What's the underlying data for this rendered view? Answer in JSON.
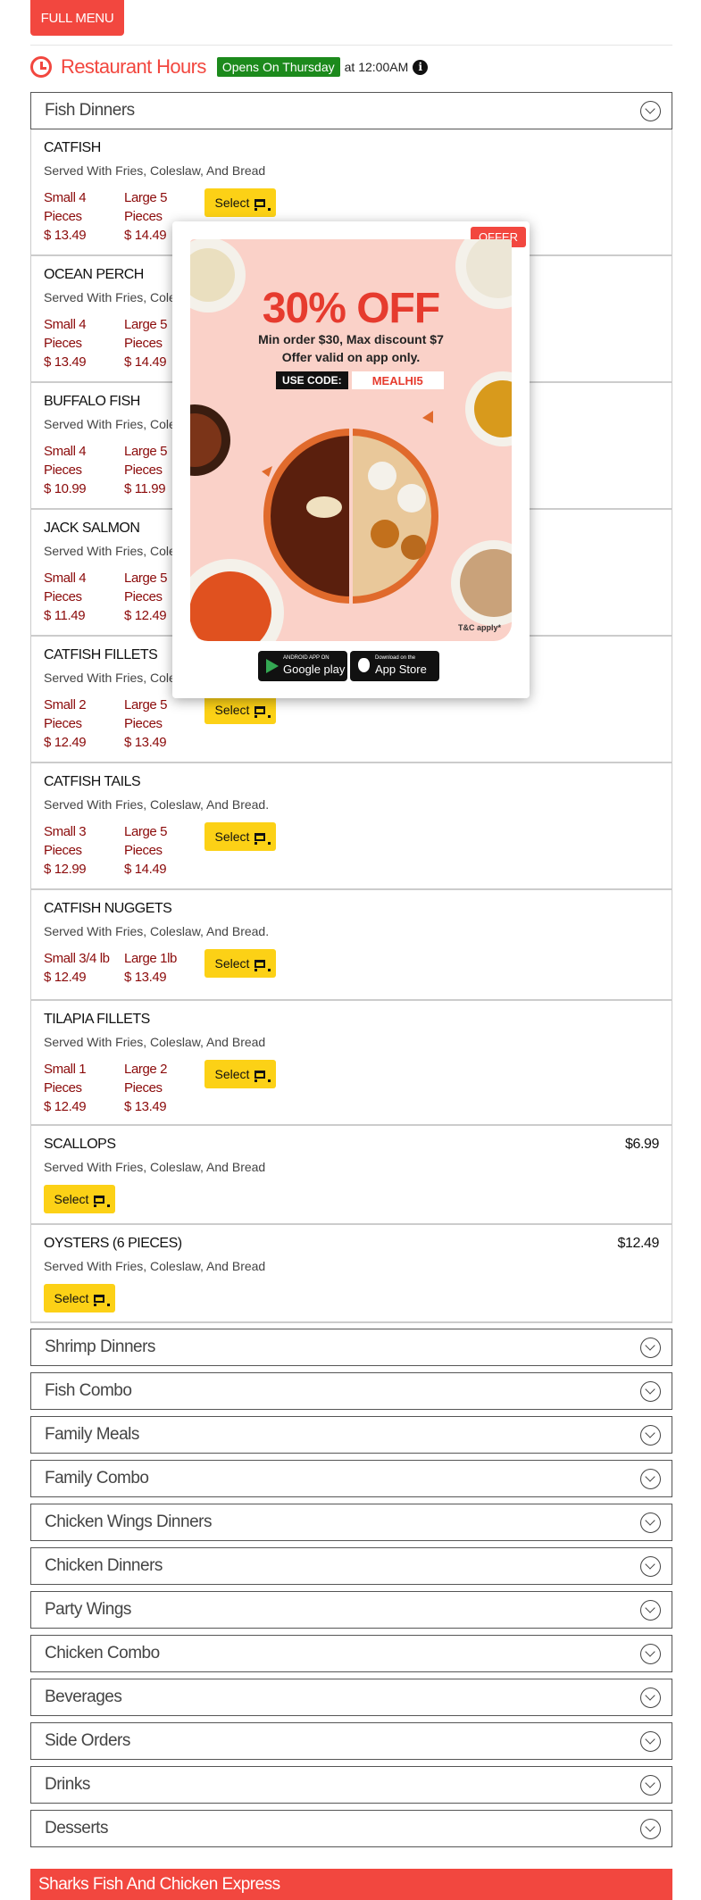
{
  "header": {
    "full_menu_label": "FULL MENU",
    "hours_title": "Restaurant Hours",
    "opens_badge": "Opens On Thursday",
    "opens_time": "at 12:00AM"
  },
  "select_label": "Select",
  "open_category": {
    "title": "Fish Dinners",
    "items": [
      {
        "name": "CATFISH",
        "desc": "Served With Fries, Coleslaw, And Bread",
        "sizes": [
          {
            "l1": "Small 4",
            "l2": "Pieces",
            "price": "$ 13.49"
          },
          {
            "l1": "Large 5",
            "l2": "Pieces",
            "price": "$ 14.49"
          }
        ]
      },
      {
        "name": "OCEAN PERCH",
        "desc": "Served With Fries, Coleslaw, And Bread",
        "sizes": [
          {
            "l1": "Small 4",
            "l2": "Pieces",
            "price": "$ 13.49"
          },
          {
            "l1": "Large 5",
            "l2": "Pieces",
            "price": "$ 14.49"
          }
        ]
      },
      {
        "name": "BUFFALO FISH",
        "desc": "Served With Fries, Coleslaw, And Bread",
        "sizes": [
          {
            "l1": "Small 4",
            "l2": "Pieces",
            "price": "$ 10.99"
          },
          {
            "l1": "Large 5",
            "l2": "Pieces",
            "price": "$ 11.99"
          }
        ]
      },
      {
        "name": "JACK SALMON",
        "desc": "Served With Fries, Coleslaw, And Bread",
        "sizes": [
          {
            "l1": "Small 4",
            "l2": "Pieces",
            "price": "$ 11.49"
          },
          {
            "l1": "Large 5",
            "l2": "Pieces",
            "price": "$ 12.49"
          }
        ]
      },
      {
        "name": "CATFISH FILLETS",
        "desc": "Served With Fries, Coleslaw, And Bread",
        "sizes": [
          {
            "l1": "Small 2",
            "l2": "Pieces",
            "price": "$ 12.49"
          },
          {
            "l1": "Large 5",
            "l2": "Pieces",
            "price": "$ 13.49"
          }
        ]
      },
      {
        "name": "CATFISH TAILS",
        "desc": "Served With Fries, Coleslaw, And Bread.",
        "sizes": [
          {
            "l1": "Small 3",
            "l2": "Pieces",
            "price": "$ 12.99"
          },
          {
            "l1": "Large 5",
            "l2": "Pieces",
            "price": "$ 14.49"
          }
        ]
      },
      {
        "name": "CATFISH NUGGETS",
        "desc": "Served With Fries, Coleslaw, And Bread.",
        "sizes": [
          {
            "l1": "Small 3/4 lb",
            "price": "$ 12.49"
          },
          {
            "l1": "Large 1lb",
            "price": "$ 13.49"
          }
        ]
      },
      {
        "name": "TILAPIA FILLETS",
        "desc": "Served With Fries, Coleslaw, And Bread",
        "sizes": [
          {
            "l1": "Small 1",
            "l2": "Pieces",
            "price": "$ 12.49"
          },
          {
            "l1": "Large 2",
            "l2": "Pieces",
            "price": "$ 13.49"
          }
        ]
      },
      {
        "name": "SCALLOPS",
        "desc": "Served With Fries, Coleslaw, And Bread",
        "price": "$6.99"
      },
      {
        "name": "OYSTERS (6 PIECES)",
        "desc": "Served With Fries, Coleslaw, And Bread",
        "price": "$12.49"
      }
    ]
  },
  "collapsed_categories": [
    "Shrimp Dinners",
    "Fish Combo",
    "Family Meals",
    "Family Combo",
    "Chicken Wings Dinners",
    "Chicken Dinners",
    "Party Wings",
    "Chicken Combo",
    "Beverages",
    "Side Orders",
    "Drinks",
    "Desserts"
  ],
  "footer_title": "Sharks Fish And Chicken Express",
  "offer_modal": {
    "tag": "OFFER",
    "headline": "30% OFF",
    "line1": "Min order $30, Max discount $7",
    "line2": "Offer valid on app only.",
    "code_label": "USE CODE:",
    "code": "MEALHI5",
    "tnc": "T&C apply*",
    "google_small": "ANDROID APP ON",
    "google_big": "Google play",
    "apple_small": "Download on the",
    "apple_big": "App Store"
  },
  "colors": {
    "brand_red": "#f2473f",
    "price_red": "#8b0a0a",
    "select_yellow": "#fcd116",
    "open_green": "#1c8a1c"
  }
}
